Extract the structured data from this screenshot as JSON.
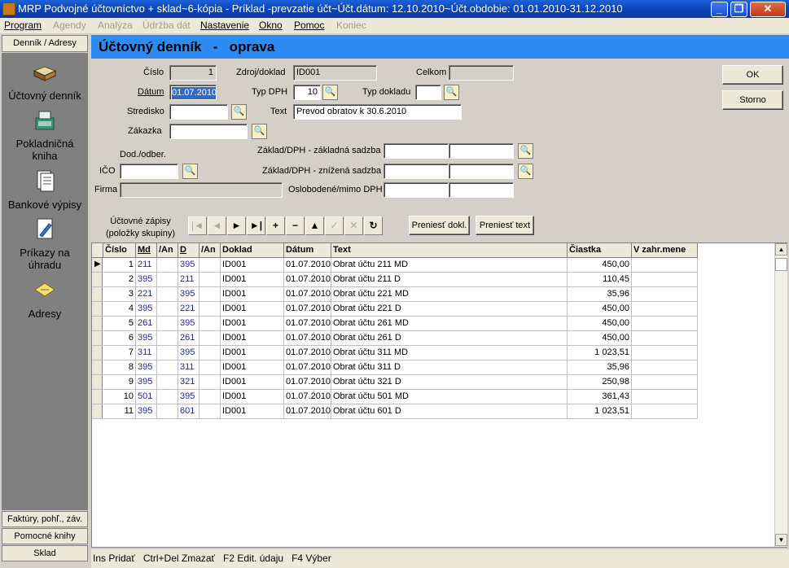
{
  "window": {
    "title": "MRP Podvojné účtovníctvo + sklad~6-kópia - Príklad -prevzatie účt~Účt.dátum: 12.10.2010~Účt.obdobie: 01.01.2010-31.12.2010",
    "minimize": "_",
    "restore": "❐",
    "close": "✕"
  },
  "menu": [
    {
      "label": "Program",
      "enabled": true
    },
    {
      "label": "Agendy",
      "enabled": false
    },
    {
      "label": "Analýza",
      "enabled": false
    },
    {
      "label": "Údržba dát",
      "enabled": false
    },
    {
      "label": "Nastavenie",
      "enabled": true
    },
    {
      "label": "Okno",
      "enabled": true
    },
    {
      "label": "Pomoc",
      "enabled": true
    },
    {
      "label": "Koniec",
      "enabled": false
    }
  ],
  "sidebar": {
    "top_tab": "Denník / Adresy",
    "items": [
      "Účtovný denník",
      "Pokladničná\nkniha",
      "Bankové výpisy",
      "Príkazy na\núhradu",
      "Adresy"
    ],
    "bottom_tabs": [
      "Faktúry, pohľ., záv.",
      "Pomocné knihy",
      "Sklad"
    ]
  },
  "banner": {
    "title": "Účtovný denník   -   oprava"
  },
  "form": {
    "cislo_label": "Číslo",
    "cislo": "1",
    "zdroj_label": "Zdroj/doklad",
    "zdroj": "ID001",
    "celkom_label": "Celkom",
    "celkom": "",
    "datum_label": "Dátum",
    "datum": "01.07.2010",
    "typdph_label": "Typ DPH",
    "typdph": "10",
    "typdokladu_label": "Typ dokladu",
    "typdokladu": "",
    "stredisko_label": "Stredisko",
    "stredisko": "",
    "text_label": "Text",
    "text": "Prevod obratov k 30.6.2010",
    "zakazka_label": "Zákazka",
    "zakazka": "",
    "dododber_label": "Dod./odber.",
    "ico_label": "IČO",
    "ico": "",
    "firma_label": "Firma",
    "firma": "",
    "zaklad_zakladna_label": "Základ/DPH - základná sadzba",
    "zaklad_znizena_label": "Základ/DPH - znížená sadzba",
    "oslobodene_label": "Oslobodené/mimo DPH",
    "zapisy_label": "Účtovné zápisy\n(položky skupiny)",
    "pick_glyph": "🔍"
  },
  "buttons": {
    "ok": "OK",
    "storno": "Storno",
    "preniest_dokl": "Preniesť dokl.",
    "preniest_text": "Preniesť text"
  },
  "navbar": [
    {
      "glyph": "|◄",
      "enabled": false
    },
    {
      "glyph": "◄",
      "enabled": false
    },
    {
      "glyph": "►",
      "enabled": true
    },
    {
      "glyph": "►|",
      "enabled": true
    },
    {
      "glyph": "+",
      "enabled": true
    },
    {
      "glyph": "−",
      "enabled": true
    },
    {
      "glyph": "▲",
      "enabled": true
    },
    {
      "glyph": "✓",
      "enabled": false
    },
    {
      "glyph": "✕",
      "enabled": false
    },
    {
      "glyph": "↻",
      "enabled": true
    }
  ],
  "grid": {
    "columns": [
      "Číslo",
      "Md",
      "/An",
      "D",
      "/An",
      "Doklad",
      "Dátum",
      "Text",
      "Čiastka",
      "V zahr.mene"
    ],
    "rows": [
      [
        "1",
        "211",
        "",
        "395",
        "",
        "ID001",
        "01.07.2010",
        "Obrat účtu 211 MD",
        "450,00",
        ""
      ],
      [
        "2",
        "395",
        "",
        "211",
        "",
        "ID001",
        "01.07.2010",
        "Obrat účtu 211 D",
        "110,45",
        ""
      ],
      [
        "3",
        "221",
        "",
        "395",
        "",
        "ID001",
        "01.07.2010",
        "Obrat účtu 221 MD",
        "35,96",
        ""
      ],
      [
        "4",
        "395",
        "",
        "221",
        "",
        "ID001",
        "01.07.2010",
        "Obrat účtu 221 D",
        "450,00",
        ""
      ],
      [
        "5",
        "261",
        "",
        "395",
        "",
        "ID001",
        "01.07.2010",
        "Obrat účtu 261 MD",
        "450,00",
        ""
      ],
      [
        "6",
        "395",
        "",
        "261",
        "",
        "ID001",
        "01.07.2010",
        "Obrat účtu 261 D",
        "450,00",
        ""
      ],
      [
        "7",
        "311",
        "",
        "395",
        "",
        "ID001",
        "01.07.2010",
        "Obrat účtu 311 MD",
        "1 023,51",
        ""
      ],
      [
        "8",
        "395",
        "",
        "311",
        "",
        "ID001",
        "01.07.2010",
        "Obrat účtu 311 D",
        "35,96",
        ""
      ],
      [
        "9",
        "395",
        "",
        "321",
        "",
        "ID001",
        "01.07.2010",
        "Obrat účtu 321 D",
        "250,98",
        ""
      ],
      [
        "10",
        "501",
        "",
        "395",
        "",
        "ID001",
        "01.07.2010",
        "Obrat účtu 501 MD",
        "361,43",
        ""
      ],
      [
        "11",
        "395",
        "",
        "601",
        "",
        "ID001",
        "01.07.2010",
        "Obrat účtu 601 D",
        "1 023,51",
        ""
      ]
    ]
  },
  "statusbar": "Ins Pridať   Ctrl+Del Zmazať   F2 Edit. údaju   F4 Výber"
}
